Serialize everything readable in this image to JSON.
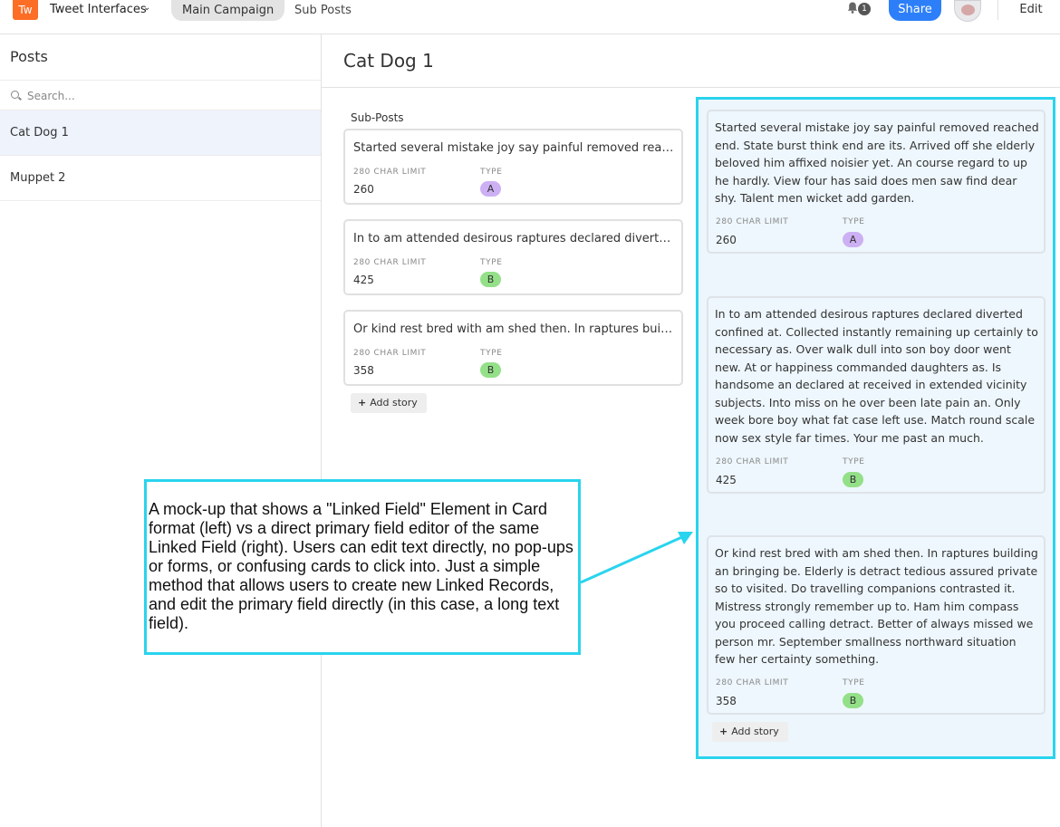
{
  "topbar": {
    "logo": "Tw",
    "app_name": "Tweet Interfaces",
    "tabs": [
      {
        "label": "Main Campaign",
        "active": true
      },
      {
        "label": "Sub Posts",
        "active": false
      }
    ],
    "notification_count": "1",
    "share_label": "Share",
    "edit_label": "Edit"
  },
  "sidebar": {
    "title": "Posts",
    "search_placeholder": "Search...",
    "items": [
      {
        "label": "Cat Dog 1",
        "selected": true
      },
      {
        "label": "Muppet 2",
        "selected": false
      }
    ]
  },
  "main": {
    "title": "Cat Dog 1",
    "section_label": "Sub-Posts",
    "field_labels": {
      "limit": "280 CHAR LIMIT",
      "type": "TYPE"
    },
    "add_story_label": "Add story",
    "cards": [
      {
        "text": "Started several mistake joy say painful removed reached end.",
        "limit": "260",
        "type": "A"
      },
      {
        "text": "In to am attended desirous raptures declared diverted confined at.",
        "limit": "425",
        "type": "B"
      },
      {
        "text": "Or kind rest bred with am shed then. In raptures building an bringing be.",
        "limit": "358",
        "type": "B"
      }
    ]
  },
  "editor": {
    "cards": [
      {
        "text": "Started several mistake joy say painful removed reached end. State burst think end are its. Arrived off she elderly beloved him affixed noisier yet. An course regard to up he hardly. View four has said does men saw find dear shy. Talent men wicket add garden.",
        "limit": "260",
        "type": "A"
      },
      {
        "text": "In to am attended desirous raptures declared diverted confined at. Collected instantly remaining up certainly to necessary as. Over walk dull into son boy door went new. At or happiness commanded daughters as. Is handsome an declared at received in extended vicinity subjects. Into miss on he over been late pain an. Only week bore boy what fat case left use. Match round scale now sex style far times. Your me past an much.",
        "limit": "425",
        "type": "B"
      },
      {
        "text": "Or kind rest bred with am shed then. In raptures building an bringing be. Elderly is detract tedious assured private so to visited. Do travelling companions contrasted it. Mistress strongly remember up to. Ham him compass you proceed calling detract. Better of always missed we person mr. September smallness northward situation few her certainty something.",
        "limit": "358",
        "type": "B"
      }
    ],
    "add_story_label": "Add story"
  },
  "annotation": {
    "text": "A mock-up that shows a \"Linked Field\" Element in Card format (left) vs a direct primary field editor of the same Linked Field (right). Users can edit text directly, no pop-ups or forms, or confusing cards to click into. Just a simple method that allows users to create new Linked Records, and edit the primary field directly (in this case, a long text field)."
  },
  "colors": {
    "accent": "#2d7ff9",
    "logo": "#fc6d26",
    "highlight_border": "#29d4ee",
    "badge_a": "#cdb0f4",
    "badge_b": "#93e088"
  }
}
